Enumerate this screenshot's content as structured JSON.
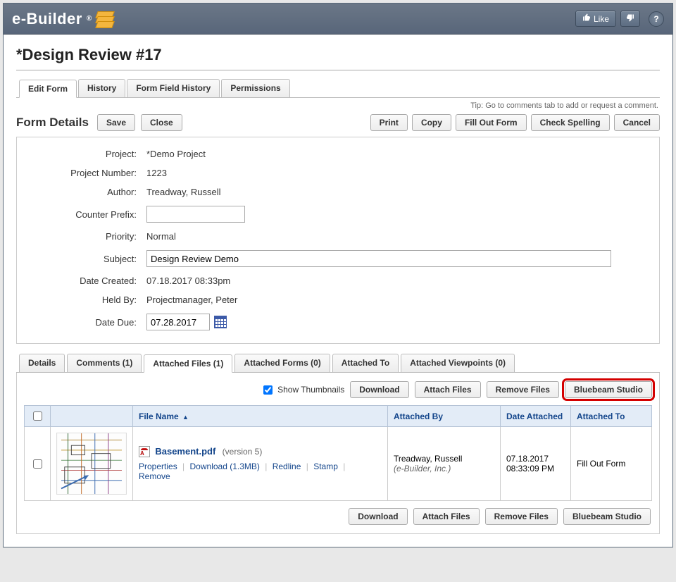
{
  "topbar": {
    "brand": "e-Builder",
    "brand_reg": "®",
    "like_label": "Like",
    "help_label": "?"
  },
  "page_title": "*Design Review #17",
  "main_tabs": [
    {
      "label": "Edit Form",
      "active": true
    },
    {
      "label": "History",
      "active": false
    },
    {
      "label": "Form Field History",
      "active": false
    },
    {
      "label": "Permissions",
      "active": false
    }
  ],
  "tip": "Tip: Go to comments tab to add or request a comment.",
  "form_details": {
    "title": "Form Details",
    "save": "Save",
    "close": "Close",
    "actions": [
      "Print",
      "Copy",
      "Fill Out Form",
      "Check Spelling",
      "Cancel"
    ],
    "rows": {
      "project_label": "Project:",
      "project_value": "*Demo Project",
      "project_number_label": "Project Number:",
      "project_number_value": "1223",
      "author_label": "Author:",
      "author_value": "Treadway, Russell",
      "counter_prefix_label": "Counter Prefix:",
      "counter_prefix_value": "",
      "priority_label": "Priority:",
      "priority_value": "Normal",
      "subject_label": "Subject:",
      "subject_value": "Design Review Demo",
      "date_created_label": "Date Created:",
      "date_created_value": "07.18.2017 08:33pm",
      "held_by_label": "Held By:",
      "held_by_value": "Projectmanager, Peter",
      "date_due_label": "Date Due:",
      "date_due_value": "07.28.2017"
    }
  },
  "sub_tabs": [
    {
      "label": "Details",
      "active": false
    },
    {
      "label": "Comments (1)",
      "active": false
    },
    {
      "label": "Attached Files (1)",
      "active": true
    },
    {
      "label": "Attached Forms (0)",
      "active": false
    },
    {
      "label": "Attached To",
      "active": false
    },
    {
      "label": "Attached Viewpoints (0)",
      "active": false
    }
  ],
  "files_panel": {
    "show_thumbs_label": "Show Thumbnails",
    "show_thumbs_checked": true,
    "buttons": [
      "Download",
      "Attach Files",
      "Remove Files",
      "Bluebeam Studio"
    ],
    "columns": {
      "file_name": "File Name",
      "attached_by": "Attached By",
      "date_attached": "Date Attached",
      "attached_to": "Attached To"
    },
    "file": {
      "name": "Basement.pdf",
      "version": "(version 5)",
      "actions": {
        "properties": "Properties",
        "download": "Download (1.3MB)",
        "redline": "Redline",
        "stamp": "Stamp",
        "remove": "Remove"
      },
      "attached_by_name": "Treadway, Russell",
      "attached_by_org": "(e-Builder, Inc.)",
      "date": "07.18.2017",
      "time": "08:33:09 PM",
      "attached_to": "Fill Out Form"
    }
  }
}
